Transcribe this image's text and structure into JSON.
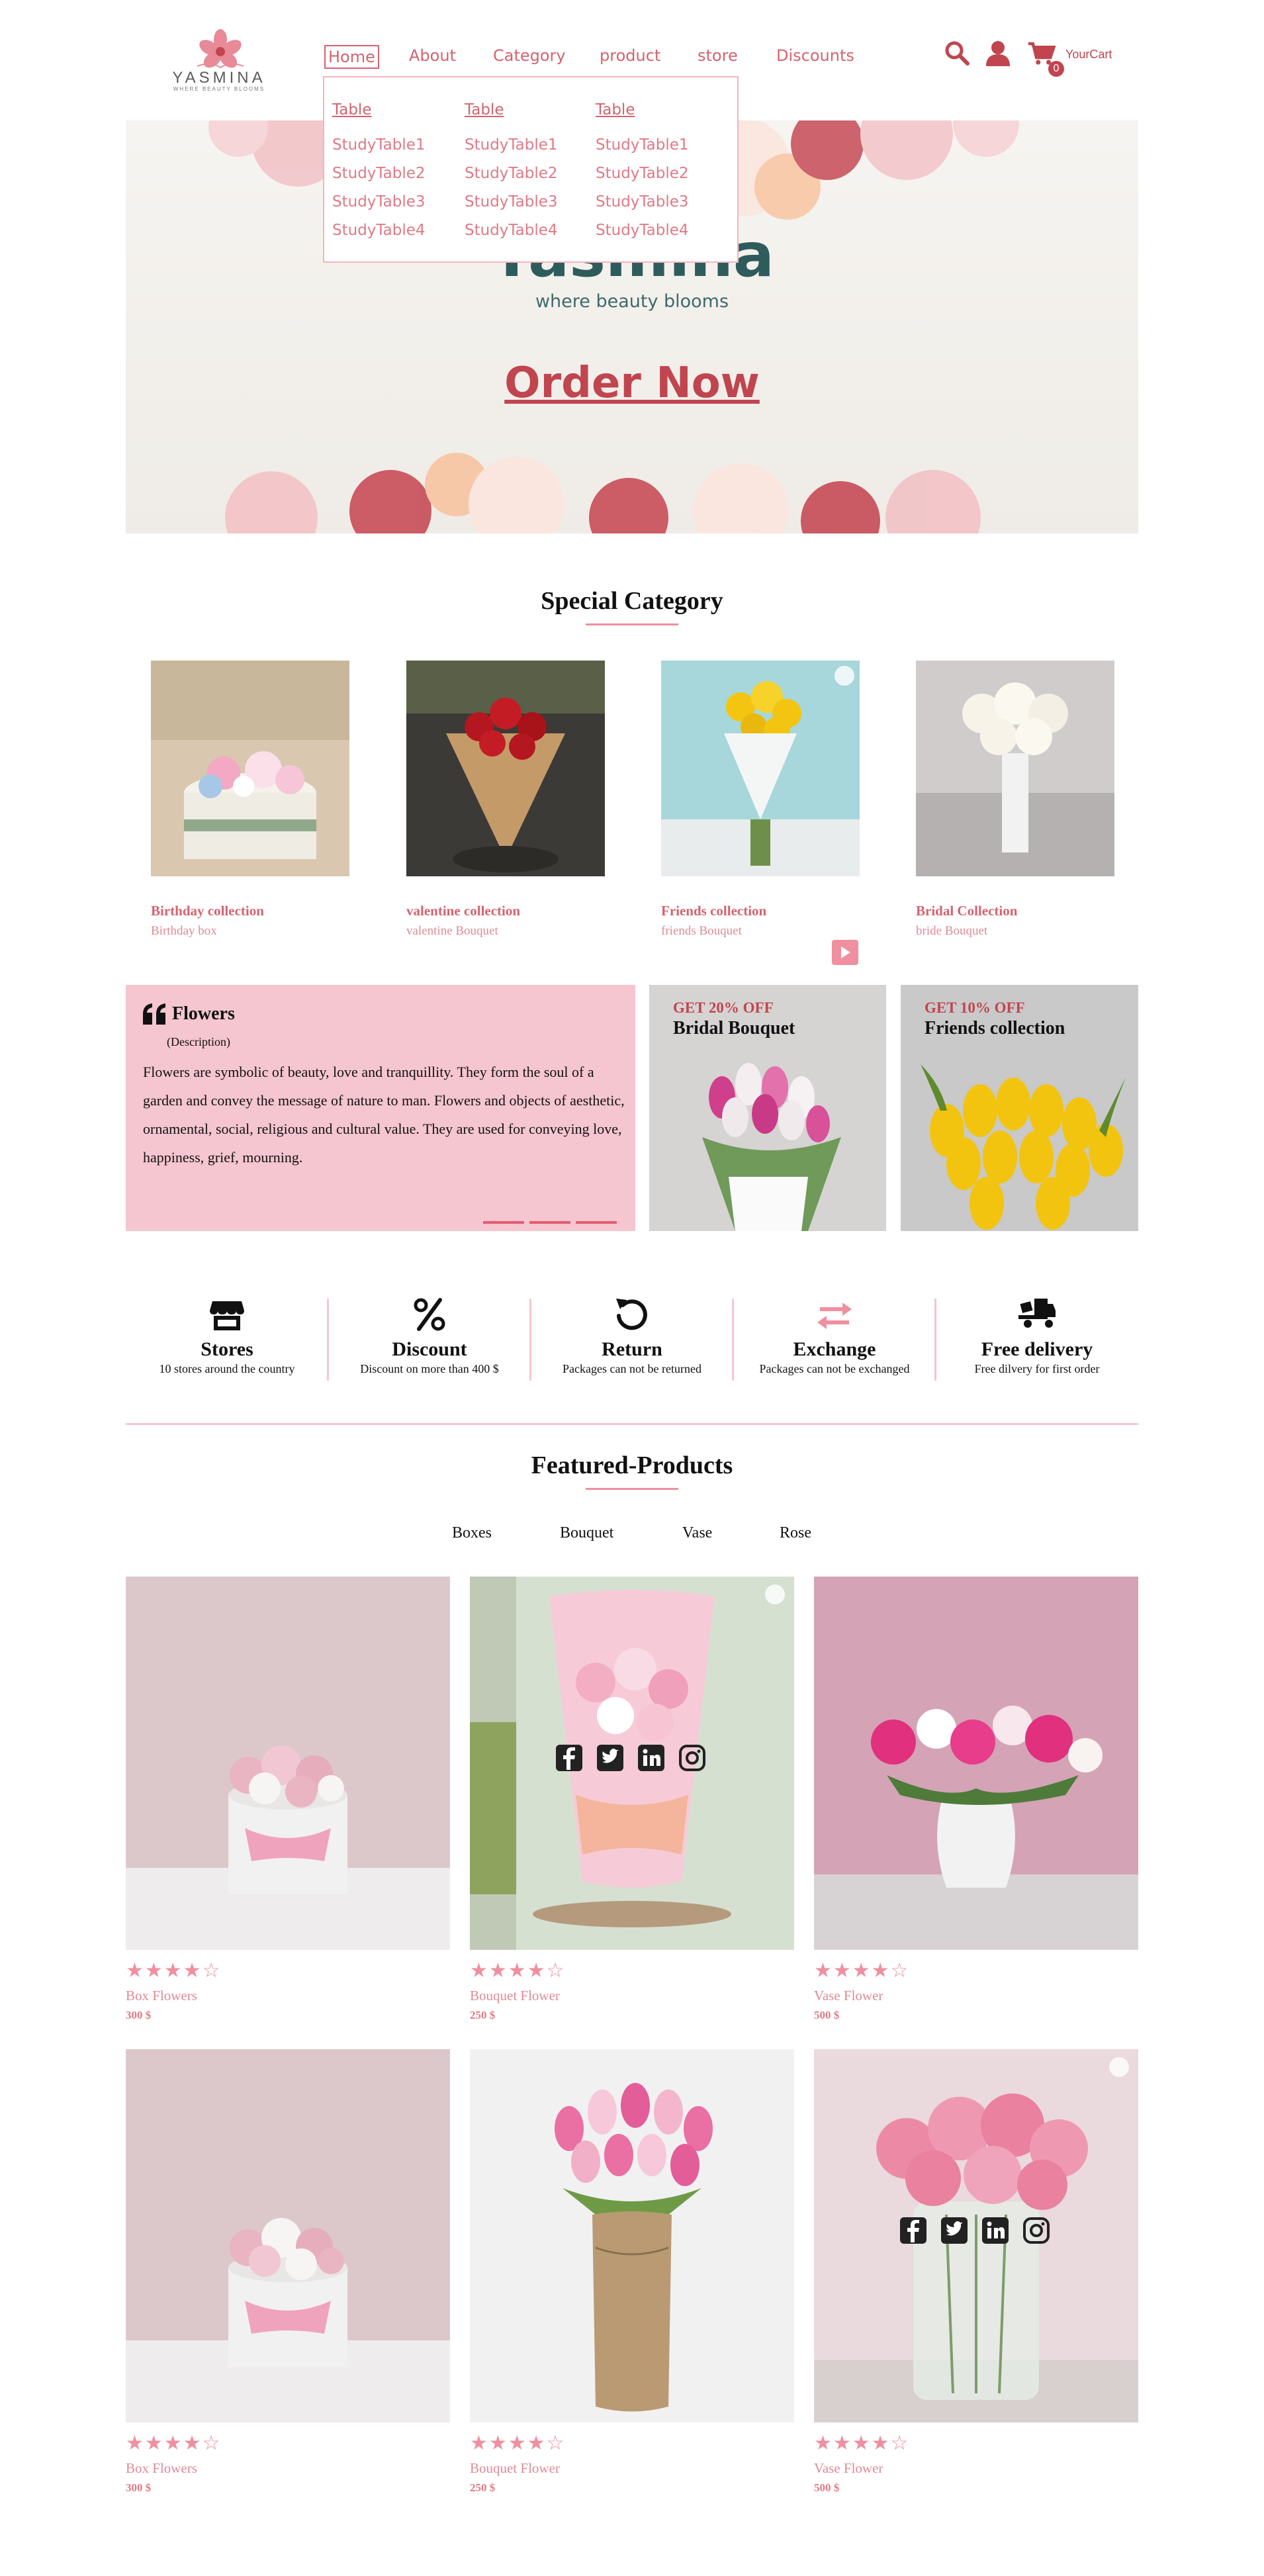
{
  "brand": {
    "name": "YASMINA",
    "tagline": "WHERE BEAUTY BLOOMS"
  },
  "nav": {
    "items": [
      "Home",
      "About",
      "Category",
      "product",
      "store",
      "Discounts"
    ]
  },
  "header": {
    "cart_label": "YourCart",
    "cart_count": "0"
  },
  "dropdown": {
    "columns": [
      {
        "heading": "Table",
        "links": [
          "StudyTable1",
          "StudyTable2",
          "StudyTable3",
          "StudyTable4"
        ]
      },
      {
        "heading": "Table",
        "links": [
          "StudyTable1",
          "StudyTable2",
          "StudyTable3",
          "StudyTable4"
        ]
      },
      {
        "heading": "Table",
        "links": [
          "StudyTable1",
          "StudyTable2",
          "StudyTable3",
          "StudyTable4"
        ]
      }
    ]
  },
  "hero": {
    "title": "Yasmina",
    "subtitle": "where beauty blooms",
    "cta": "Order Now"
  },
  "special": {
    "title": "Special Category",
    "cards": [
      {
        "title": "Birthday collection",
        "sub": "Birthday box"
      },
      {
        "title": "valentine collection",
        "sub": "valentine Bouquet"
      },
      {
        "title": "Friends collection",
        "sub": "friends Bouquet"
      },
      {
        "title": "Bridal Collection",
        "sub": "bride Bouquet"
      }
    ]
  },
  "quote": {
    "title": "Flowers",
    "desc": "(Description)",
    "text": "Flowers are symbolic of beauty, love and tranquillity. They form the soul of a garden and convey the message of nature to man. Flowers and objects of aesthetic, ornamental, social, religious and cultural value. They are used for conveying love, happiness, grief, mourning."
  },
  "promos": [
    {
      "off": "GET 20% OFF",
      "name": "Bridal Bouquet"
    },
    {
      "off": "GET 10% OFF",
      "name": "Friends collection"
    }
  ],
  "features": [
    {
      "title": "Stores",
      "sub": "10 stores around the country",
      "icon": "store-icon"
    },
    {
      "title": "Discount",
      "sub": "Discount on more than 400 $",
      "icon": "percent-icon"
    },
    {
      "title": "Return",
      "sub": "Packages can not be returned",
      "icon": "return-icon"
    },
    {
      "title": "Exchange",
      "sub": "Packages can not be exchanged",
      "icon": "exchange-icon"
    },
    {
      "title": "Free delivery",
      "sub": "Free dilvery for first order",
      "icon": "delivery-truck-icon"
    }
  ],
  "featured": {
    "title": "Featured-Products",
    "tabs": [
      "Boxes",
      "Bouquet",
      "Vase",
      "Rose"
    ],
    "products": [
      {
        "name": "Box Flowers",
        "price": "300 $",
        "rating": 4
      },
      {
        "name": "Bouquet Flower",
        "price": "250 $",
        "rating": 4
      },
      {
        "name": "Vase Flower",
        "price": "500 $",
        "rating": 4
      },
      {
        "name": "Box Flowers",
        "price": "300 $",
        "rating": 4
      },
      {
        "name": "Bouquet Flower",
        "price": "250 $",
        "rating": 4
      },
      {
        "name": "Vase Flower",
        "price": "500 $",
        "rating": 4
      }
    ]
  },
  "colors": {
    "accent": "#d4636f",
    "pink": "#ef8fa0",
    "soft_pink": "#f5c6cf",
    "teal": "#2e5c5c"
  }
}
